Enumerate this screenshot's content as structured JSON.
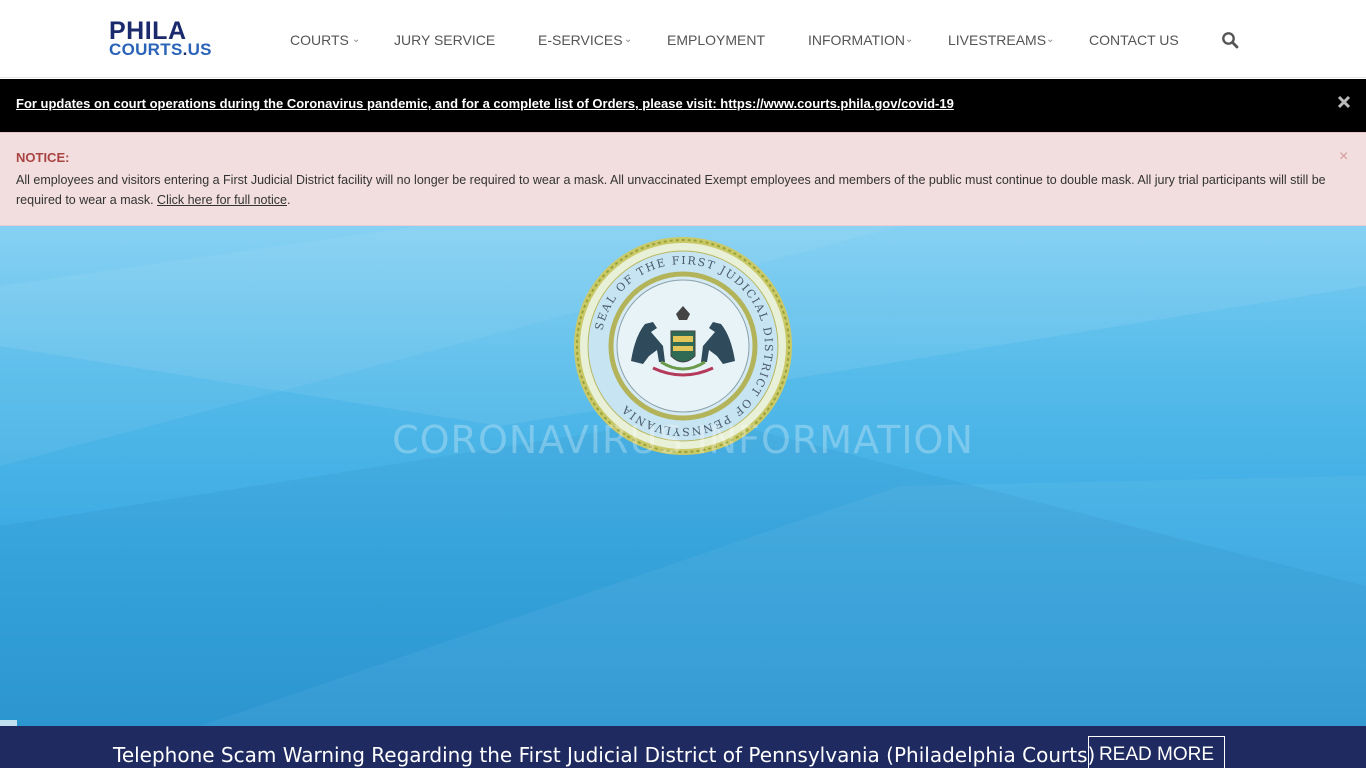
{
  "header": {
    "logo_top": "PHILA",
    "logo_bottom_a": "COURTS",
    "logo_bottom_dot": ".",
    "logo_bottom_b": "US",
    "nav": [
      {
        "label": "COURTS",
        "dropdown": true
      },
      {
        "label": "JURY SERVICE",
        "dropdown": false
      },
      {
        "label": "E-SERVICES",
        "dropdown": true
      },
      {
        "label": "EMPLOYMENT",
        "dropdown": false
      },
      {
        "label": "INFORMATION",
        "dropdown": true
      },
      {
        "label": "LIVESTREAMS",
        "dropdown": true
      },
      {
        "label": "CONTACT US",
        "dropdown": false
      }
    ],
    "search_icon": "search-icon"
  },
  "covid_banner": {
    "text": "For updates on court operations during the Coronavirus pandemic, and for a complete list of Orders, please visit: https://www.courts.phila.gov/covid-19",
    "close_icon": "close-icon"
  },
  "notice": {
    "title": "NOTICE:",
    "body": "All employees and visitors entering a First Judicial District facility will no longer be required to wear a mask. All unvaccinated Exempt employees and members of the public must continue to double mask. All jury trial participants will still be required to wear a mask.",
    "link": "Click here for full notice",
    "trailing": ".",
    "close": "×"
  },
  "hero": {
    "title": "CORONAVIRUS INFORMATION",
    "seal_text": "SEAL OF THE FIRST JUDICIAL DISTRICT OF PENNSYLVANIA"
  },
  "news": {
    "headline": "Telephone Scam Warning Regarding the First Judicial District of Pennsylvania (Philadelphia Courts)",
    "button": "READ MORE"
  },
  "colors": {
    "brand_navy": "#1a2a6c",
    "brand_blue": "#2a63b8",
    "notice_bg": "#f2dede",
    "notice_title": "#a94442",
    "news_bar": "#1f2a60"
  }
}
